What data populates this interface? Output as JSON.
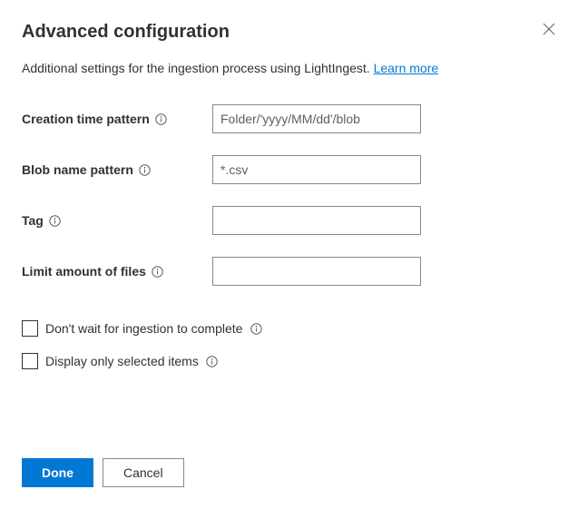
{
  "title": "Advanced configuration",
  "subtitle_prefix": "Additional settings for the ingestion process using LightIngest. ",
  "learn_more": "Learn more",
  "fields": {
    "creation_time": {
      "label": "Creation time pattern",
      "placeholder": "Folder/'yyyy/MM/dd'/blob",
      "value": ""
    },
    "blob_name": {
      "label": "Blob name pattern",
      "placeholder": "*.csv",
      "value": ""
    },
    "tag": {
      "label": "Tag",
      "placeholder": "",
      "value": ""
    },
    "limit_files": {
      "label": "Limit amount of files",
      "placeholder": "",
      "value": ""
    }
  },
  "checkboxes": {
    "dont_wait": {
      "label": "Don't wait for ingestion to complete"
    },
    "display_selected": {
      "label": "Display only selected items"
    }
  },
  "buttons": {
    "done": "Done",
    "cancel": "Cancel"
  }
}
